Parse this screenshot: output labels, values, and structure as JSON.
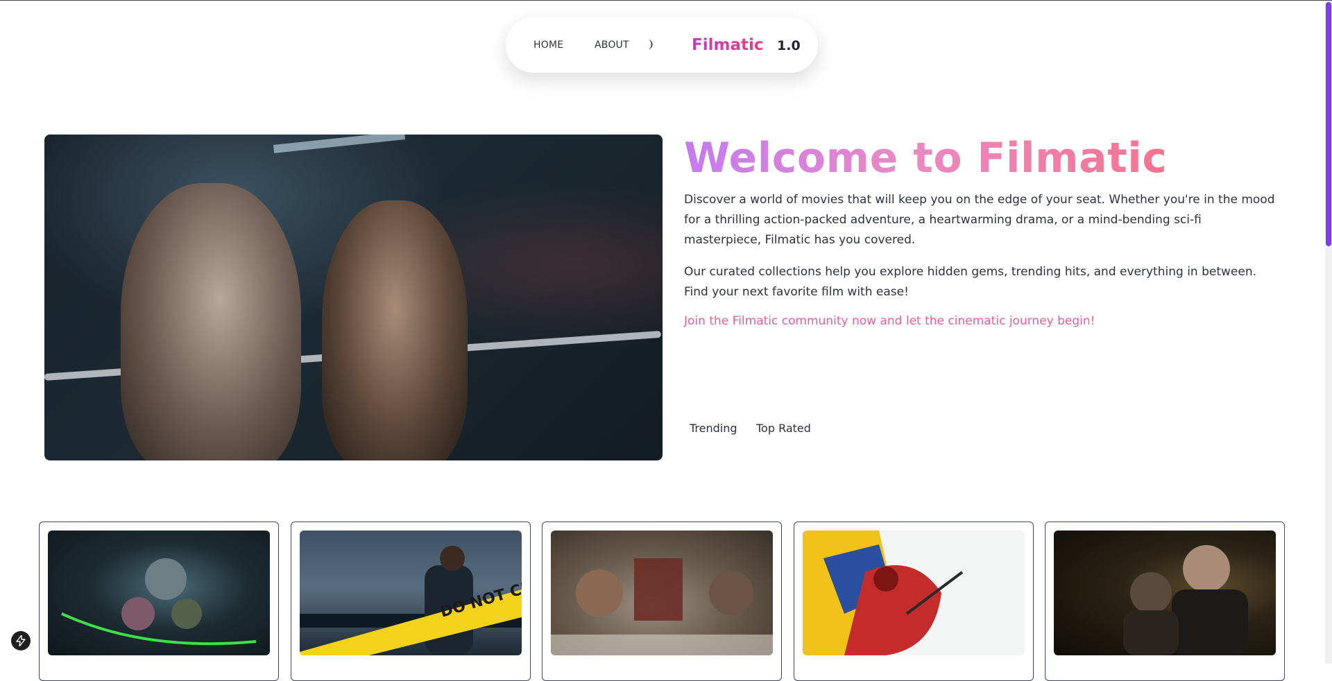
{
  "nav": {
    "home": "HOME",
    "about": "ABOUT",
    "brand": "Filmatic",
    "version": "1.0"
  },
  "hero": {
    "title": "Welcome to Filmatic",
    "paragraph1": "Discover a world of movies that will keep you on the edge of your seat. Whether you're in the mood for a thrilling action-packed adventure, a heartwarming drama, or a mind-bending sci-fi masterpiece, Filmatic has you covered.",
    "paragraph2": "Our curated collections help you explore hidden gems, trending hits, and everything in between. Find your next favorite film with ease!",
    "cta": "Join the Filmatic community now and let the cinematic journey begin!"
  },
  "tabs": [
    "Trending",
    "Top Rated"
  ],
  "posters": [
    {
      "icon": "animated-heroes-poster"
    },
    {
      "icon": "detective-poster",
      "tape_text": "DO NOT CROSS"
    },
    {
      "icon": "gladiator-poster"
    },
    {
      "icon": "deadpool-wolverine-poster"
    },
    {
      "icon": "city-noir-poster"
    }
  ],
  "colors": {
    "brand_start": "#c03cc6",
    "brand_end": "#ec3f7a",
    "cta": "#e95d9b",
    "scrollbar": "#7b3fe4"
  }
}
